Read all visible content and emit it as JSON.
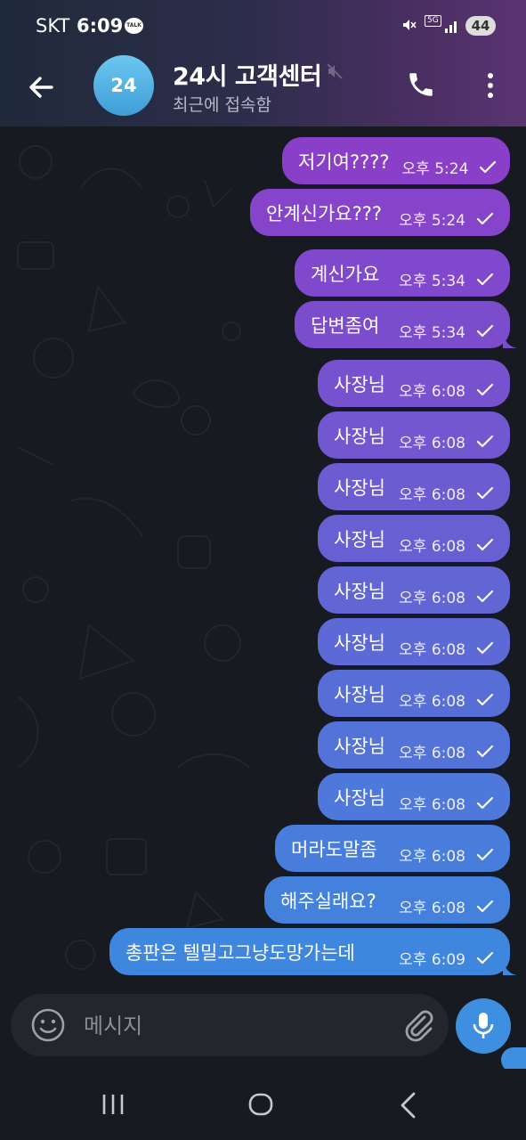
{
  "status_bar": {
    "carrier": "SKT",
    "time": "6:09",
    "talk_badge": "TALK",
    "network": "5G",
    "battery": "44"
  },
  "header": {
    "avatar_text": "24",
    "title": "24시 고객센터",
    "status": "최근에 접속함"
  },
  "messages": [
    {
      "text": "저기여????",
      "time": "오후 5:24"
    },
    {
      "text": "안계신가요???",
      "time": "오후 5:24"
    },
    {
      "text": "계신가요",
      "time": "오후 5:34"
    },
    {
      "text": "답변좀여",
      "time": "오후 5:34"
    },
    {
      "text": "사장님",
      "time": "오후 6:08"
    },
    {
      "text": "사장님",
      "time": "오후 6:08"
    },
    {
      "text": "사장님",
      "time": "오후 6:08"
    },
    {
      "text": "사장님",
      "time": "오후 6:08"
    },
    {
      "text": "사장님",
      "time": "오후 6:08"
    },
    {
      "text": "사장님",
      "time": "오후 6:08"
    },
    {
      "text": "사장님",
      "time": "오후 6:08"
    },
    {
      "text": "사장님",
      "time": "오후 6:08"
    },
    {
      "text": "사장님",
      "time": "오후 6:08"
    },
    {
      "text": "머라도말좀",
      "time": "오후 6:08"
    },
    {
      "text": "해주실래요?",
      "time": "오후 6:08"
    },
    {
      "text": "총판은 텔밀고그냥도망가는데",
      "time": "오후 6:09"
    }
  ],
  "input": {
    "placeholder": "메시지"
  },
  "icons": {
    "back": "arrow-left-icon",
    "call": "phone-icon",
    "menu": "more-vertical-icon",
    "emoji": "smiley-icon",
    "attach": "paperclip-icon",
    "mic": "microphone-icon"
  },
  "colors": {
    "bubble_top": "#8a3fc9",
    "bubble_bottom": "#3f86de",
    "accent": "#3f8fe0",
    "header_right": "#5a3472"
  }
}
